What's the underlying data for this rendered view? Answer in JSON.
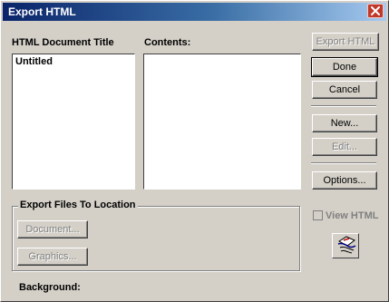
{
  "window": {
    "title": "Export HTML"
  },
  "labels": {
    "doc_title": "HTML Document Title",
    "contents": "Contents:"
  },
  "doc_list": {
    "items": [
      "Untitled"
    ]
  },
  "contents_list": {
    "items": []
  },
  "buttons": {
    "export_html": "Export HTML",
    "done": "Done",
    "cancel": "Cancel",
    "new": "New...",
    "edit": "Edit...",
    "options": "Options...",
    "document": "Document...",
    "graphics": "Graphics..."
  },
  "groupbox": {
    "title": "Export Files To Location"
  },
  "checkbox": {
    "label": "View HTML",
    "checked": false,
    "enabled": false
  },
  "icon_button": {
    "icon": "html-wizard-icon"
  },
  "status": {
    "text": "Background:"
  },
  "colors": {
    "titlebar_start": "#0a246a",
    "titlebar_end": "#a6caf0",
    "face": "#d4d0c8",
    "close": "#c0392b"
  }
}
